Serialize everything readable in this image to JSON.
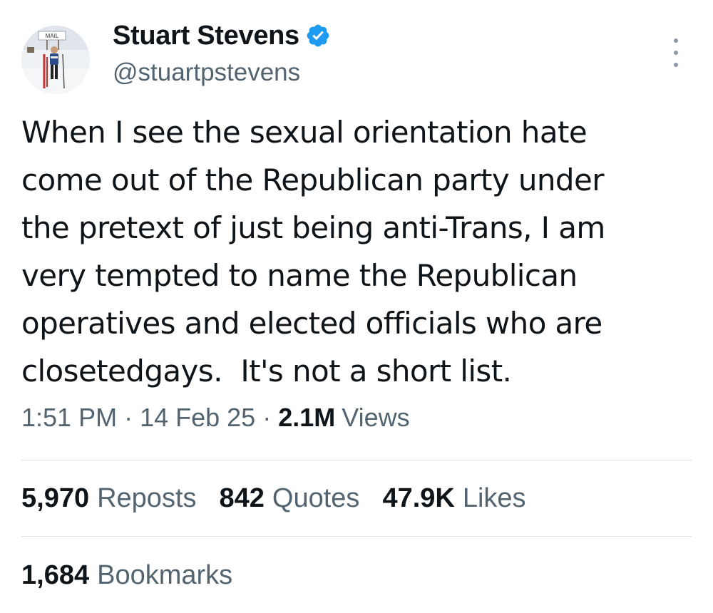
{
  "author": {
    "display_name": "Stuart Stevens",
    "handle": "@stuartpstevens",
    "verified_color": "#1d9bf0",
    "avatar_sign_text": "MAIL"
  },
  "tweet": {
    "text": "When I see the sexual orientation hate\ncome out of the Republican party under\nthe pretext of just being anti-Trans, I am\nvery tempted to name the Republican\noperatives and elected officials who are\nclosetedgays.  It's not a short list.",
    "time": "1:51 PM",
    "separator": "·",
    "date": "14 Feb 25",
    "views_count": "2.1M",
    "views_label": "Views"
  },
  "stats": {
    "reposts_count": "5,970",
    "reposts_label": "Reposts",
    "quotes_count": "842",
    "quotes_label": "Quotes",
    "likes_count": "47.9K",
    "likes_label": "Likes",
    "bookmarks_count": "1,684",
    "bookmarks_label": "Bookmarks"
  },
  "icons": {
    "verified": "verified-badge-icon",
    "more": "more-options-icon"
  }
}
